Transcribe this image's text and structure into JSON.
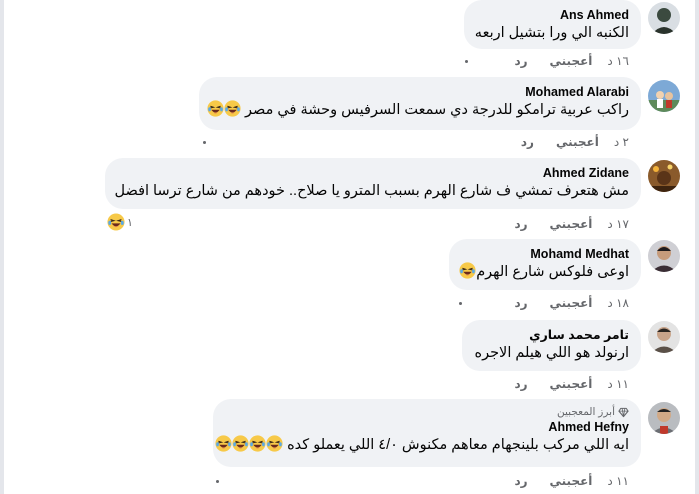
{
  "comments": [
    {
      "author": "Ans Ahmed",
      "text": "الكنبه الي ورا بتشيل اربعه",
      "time": "١٦ د",
      "like_label": "أعجبني",
      "reply_label": "رد",
      "avatar_color": "#3b4a3f"
    },
    {
      "author": "Mohamed Alarabi",
      "text": "راكب عربية ترامكو للدرجة دي سمعت السرفيس وحشة في مصر",
      "time": "٢ د",
      "like_label": "أعجبني",
      "reply_label": "رد",
      "avatar_color": "#7da9d6"
    },
    {
      "author": "Ahmed Zidane",
      "text": "مش هتعرف تمشي ف شارع الهرم بسبب المترو يا صلاح.. خودهم من شارع ترسا افضل",
      "time": "١٧ د",
      "like_label": "أعجبني",
      "reply_label": "رد",
      "reaction_count": "١",
      "avatar_color": "#8a5a2b"
    },
    {
      "author": "Mohamd Medhat",
      "text": "اوعى فلوكس شارع الهرم",
      "time": "١٨ د",
      "like_label": "أعجبني",
      "reply_label": "رد",
      "avatar_color": "#3a2d34"
    },
    {
      "author": "تامر محمد ساري",
      "text": "ارنولد هو اللي هيلم الاجره",
      "time": "١١ د",
      "like_label": "أعجبني",
      "reply_label": "رد",
      "avatar_color": "#5a5048"
    },
    {
      "author": "Ahmed Hefny",
      "badge": "أبرز المعجبين",
      "text": "ايه اللي مركب بلينجهام معاهم مكنوش ٤/٠ اللي يعملو كده",
      "time": "١١ د",
      "like_label": "أعجبني",
      "reply_label": "رد",
      "avatar_color": "#6b6e73"
    }
  ],
  "colors": {
    "bubble_bg": "#f0f2f5",
    "secondary_text": "#65676b",
    "emoji_yellow": "#f7c948"
  },
  "icons": {
    "emoji": "laughing-tears-emoji",
    "badge": "diamond-icon"
  }
}
